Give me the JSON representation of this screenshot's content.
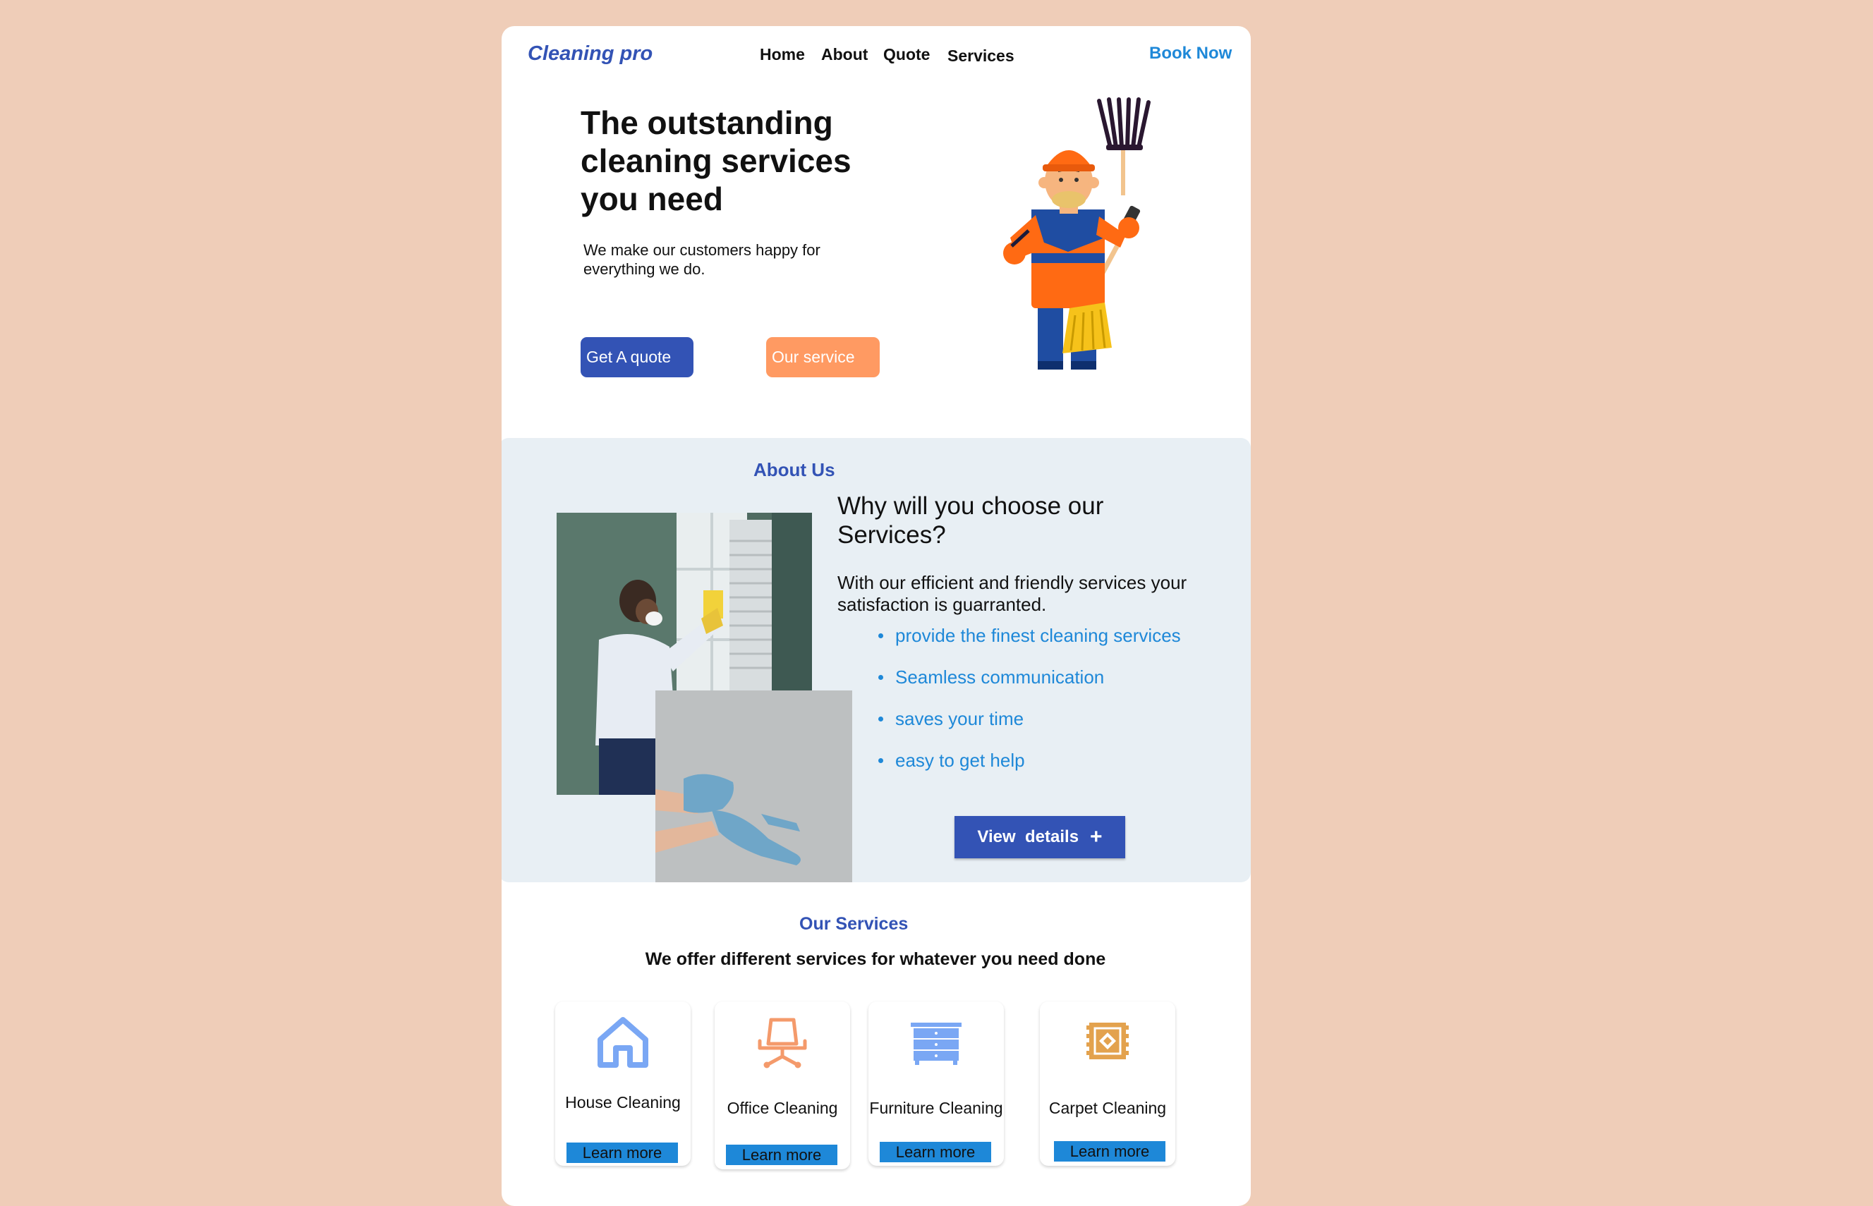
{
  "header": {
    "logo": "Cleaning pro",
    "nav": [
      "Home",
      "About",
      "Quote",
      "Services"
    ],
    "cta": "Book Now"
  },
  "hero": {
    "title": "The outstanding cleaning services you need",
    "subtitle": "We make our customers happy for everything we do.",
    "primary_button": "Get A quote",
    "secondary_button": "Our service"
  },
  "about": {
    "label": "About Us",
    "title": "Why will you choose our Services?",
    "text": "With our efficient and friendly services your satisfaction is guarranted.",
    "bullets": [
      "provide the finest cleaning services",
      "Seamless communication",
      "saves your time",
      "easy to get help"
    ],
    "button": "View  details"
  },
  "services": {
    "label": "Our Services",
    "subtitle": "We offer different services for whatever you need done",
    "cards": [
      {
        "name": "House Cleaning",
        "button": "Learn more",
        "icon": "house-icon",
        "color": "#7AA7F4"
      },
      {
        "name": "Office Cleaning",
        "button": "Learn more",
        "icon": "office-chair-icon",
        "color": "#F49A6B"
      },
      {
        "name": "Furniture Cleaning",
        "button": "Learn more",
        "icon": "dresser-icon",
        "color": "#7AA7F4"
      },
      {
        "name": "Carpet Cleaning",
        "button": "Learn more",
        "icon": "carpet-icon",
        "color": "#E3A24E"
      }
    ]
  },
  "colors": {
    "background": "#EFCDB8",
    "brand_blue": "#3353B5",
    "accent_blue": "#1E88D8",
    "accent_orange": "#FF9A62",
    "about_bg": "#E8EFF4"
  }
}
